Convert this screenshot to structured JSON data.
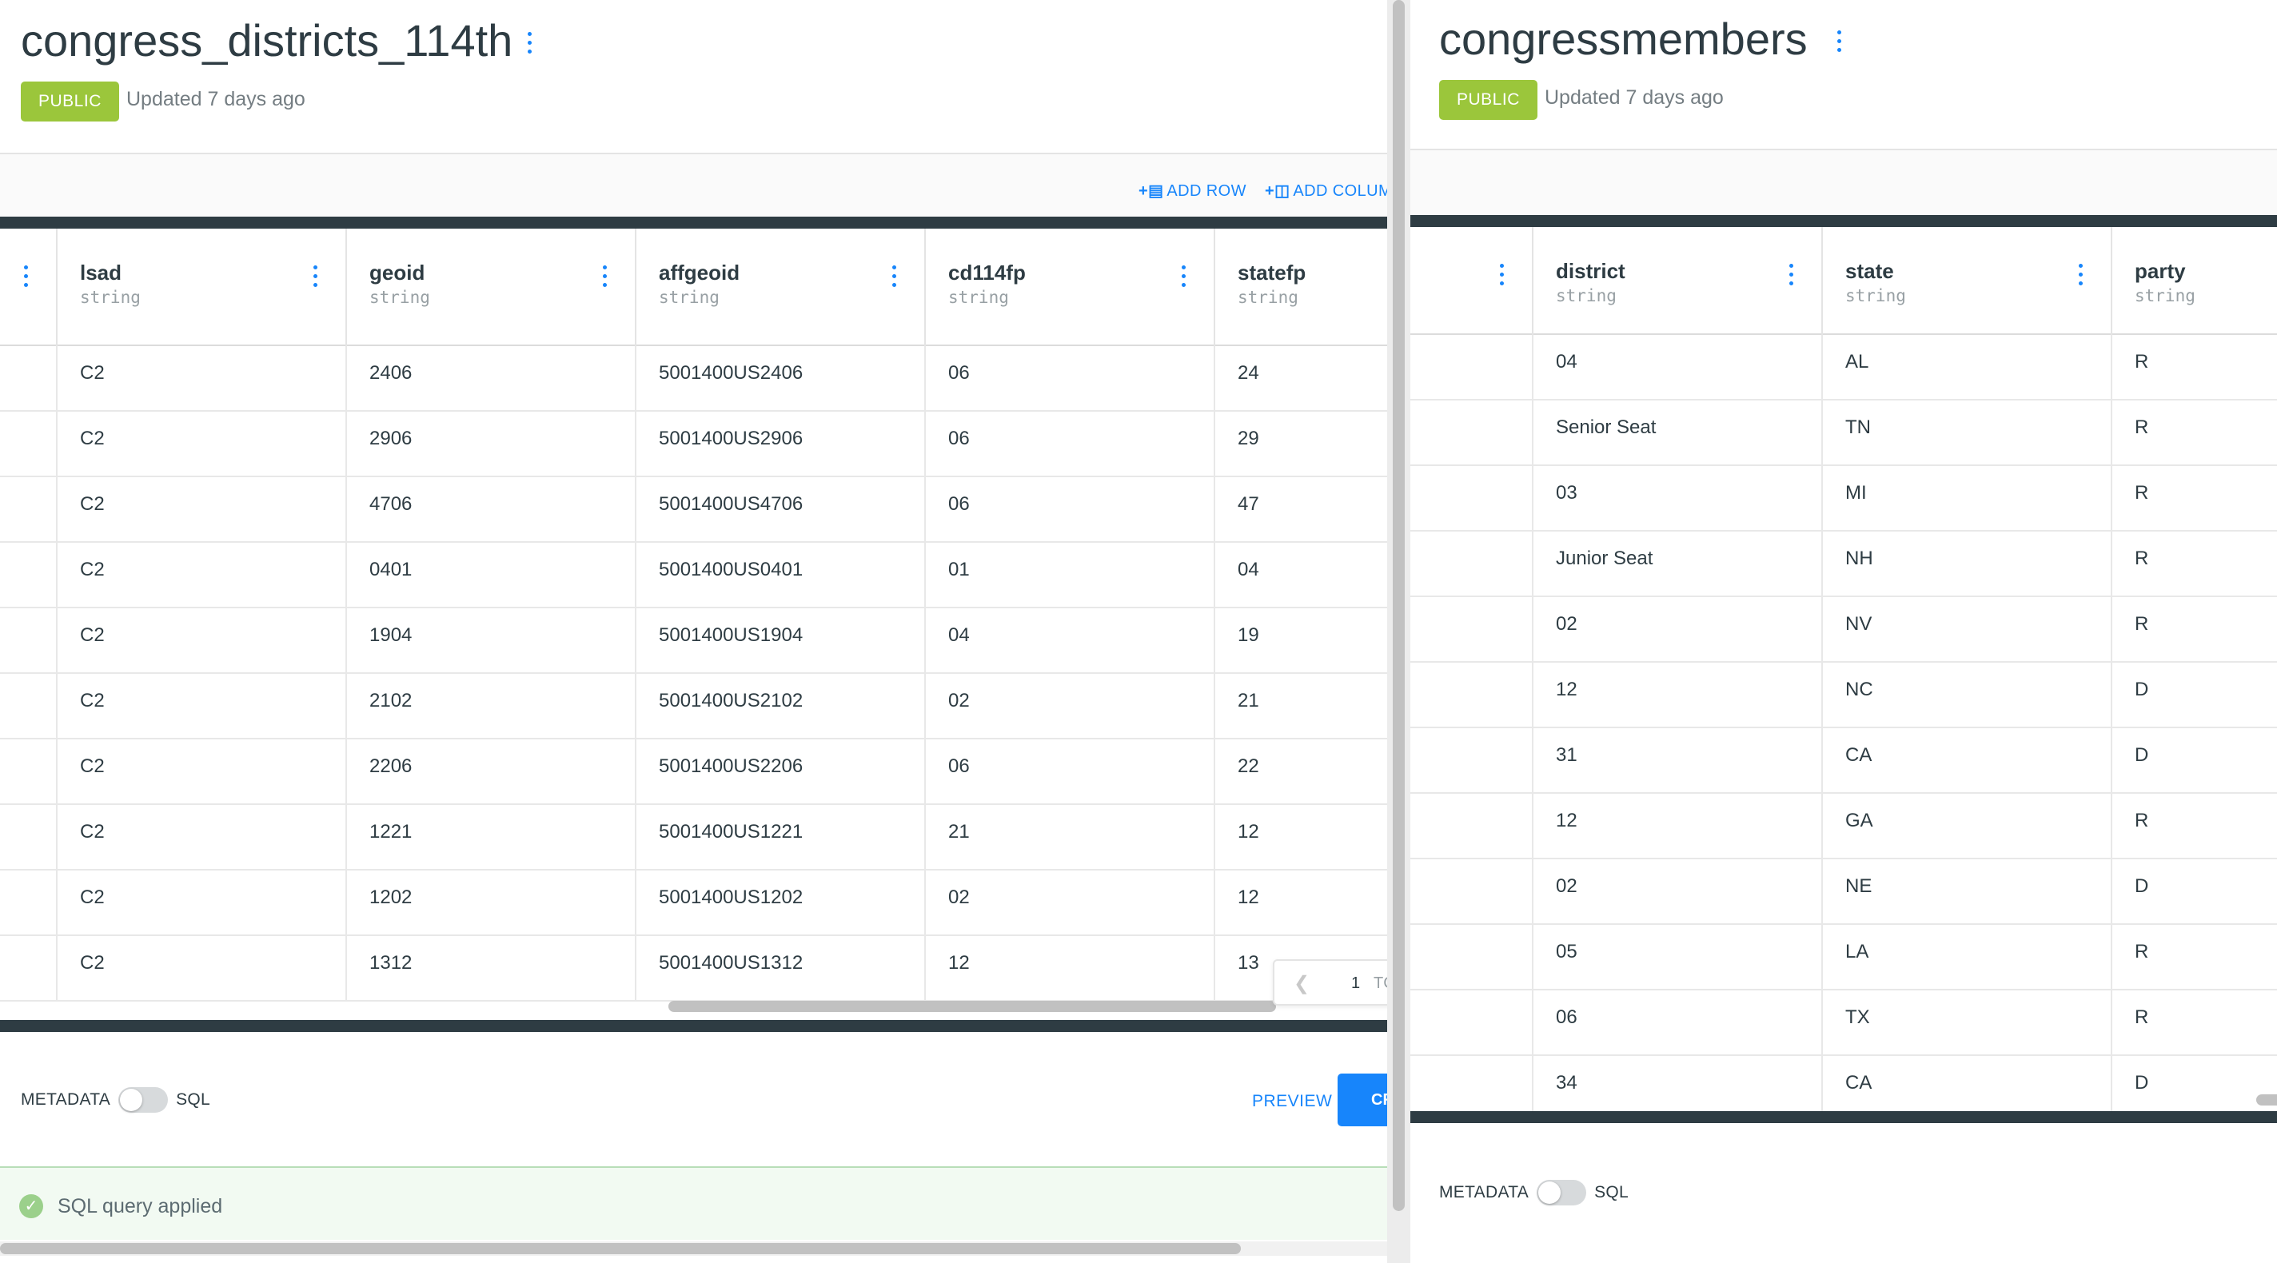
{
  "left": {
    "title": "congress_districts_114th",
    "badge": "PUBLIC",
    "updated": "Updated 7 days ago",
    "toolbar": {
      "add_row": "ADD ROW",
      "add_column": "ADD COLUM",
      "add_row_icon": "plus-row-icon",
      "add_column_icon": "plus-column-icon"
    },
    "columns": [
      {
        "name": "lsad",
        "type": "string"
      },
      {
        "name": "geoid",
        "type": "string"
      },
      {
        "name": "affgeoid",
        "type": "string"
      },
      {
        "name": "cd114fp",
        "type": "string"
      },
      {
        "name": "statefp",
        "type": "string"
      }
    ],
    "rows": [
      [
        "C2",
        "2406",
        "5001400US2406",
        "06",
        "24"
      ],
      [
        "C2",
        "2906",
        "5001400US2906",
        "06",
        "29"
      ],
      [
        "C2",
        "4706",
        "5001400US4706",
        "06",
        "47"
      ],
      [
        "C2",
        "0401",
        "5001400US0401",
        "01",
        "04"
      ],
      [
        "C2",
        "1904",
        "5001400US1904",
        "04",
        "19"
      ],
      [
        "C2",
        "2102",
        "5001400US2102",
        "02",
        "21"
      ],
      [
        "C2",
        "2206",
        "5001400US2206",
        "06",
        "22"
      ],
      [
        "C2",
        "1221",
        "5001400US1221",
        "21",
        "12"
      ],
      [
        "C2",
        "1202",
        "5001400US1202",
        "02",
        "12"
      ],
      [
        "C2",
        "1312",
        "5001400US1312",
        "12",
        "13"
      ]
    ],
    "pager": {
      "page": "1",
      "to": "TC"
    },
    "metadata_label": "METADATA",
    "sql_label": "SQL",
    "preview_label": "PREVIEW",
    "create_label": "CR",
    "status_message": "SQL query applied"
  },
  "right": {
    "title": "congressmembers",
    "badge": "PUBLIC",
    "updated": "Updated 7 days ago",
    "columns": [
      {
        "name": "district",
        "type": "string"
      },
      {
        "name": "state",
        "type": "string"
      },
      {
        "name": "party",
        "type": "string"
      }
    ],
    "rows": [
      [
        "04",
        "AL",
        "R"
      ],
      [
        "Senior Seat",
        "TN",
        "R"
      ],
      [
        "03",
        "MI",
        "R"
      ],
      [
        "Junior Seat",
        "NH",
        "R"
      ],
      [
        "02",
        "NV",
        "R"
      ],
      [
        "12",
        "NC",
        "D"
      ],
      [
        "31",
        "CA",
        "D"
      ],
      [
        "12",
        "GA",
        "R"
      ],
      [
        "02",
        "NE",
        "D"
      ],
      [
        "05",
        "LA",
        "R"
      ],
      [
        "06",
        "TX",
        "R"
      ],
      [
        "34",
        "CA",
        "D"
      ]
    ],
    "metadata_label": "METADATA",
    "sql_label": "SQL"
  },
  "colors": {
    "accent": "#1785fb",
    "public_badge": "#9bc63b",
    "dark_bar": "#2e3c43",
    "success": "#9bd08b"
  }
}
